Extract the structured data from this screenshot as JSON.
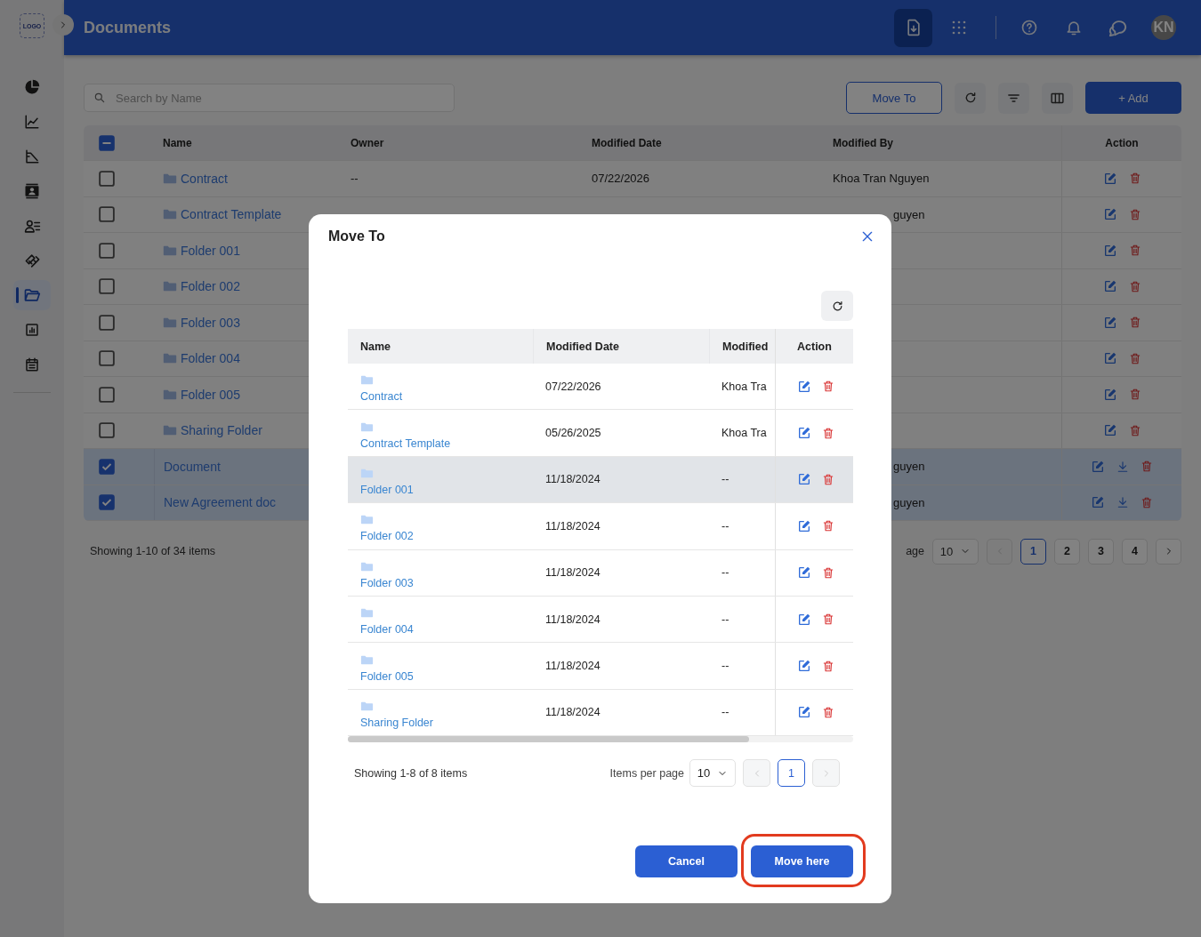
{
  "sidebar": {
    "logo": "LOGO",
    "items": [
      {
        "selected": false
      },
      {
        "selected": false
      },
      {
        "selected": false
      },
      {
        "selected": false
      },
      {
        "selected": false
      },
      {
        "selected": false
      },
      {
        "selected": true
      },
      {
        "selected": false
      },
      {
        "selected": false
      }
    ]
  },
  "header": {
    "title": "Documents",
    "avatar": "KN",
    "tools": [
      {
        "selected": true
      },
      {
        "selected": false
      }
    ]
  },
  "toolbar": {
    "search_placeholder": "Search by Name",
    "move_button": "Move To",
    "add_button": "+ Add"
  },
  "table": {
    "select_all": {
      "indeterminate": true
    },
    "columns": [
      "Name",
      "Owner",
      "Modified Date",
      "Modified By",
      "Action"
    ],
    "rows": [
      {
        "kind": "folder",
        "checked": false,
        "name": "Contract",
        "owner": "--",
        "modified_date": "07/22/2026",
        "modified_by": "Khoa Tran Nguyen"
      },
      {
        "kind": "folder",
        "checked": false,
        "name": "Contract Template",
        "modified_by_tail": "guyen"
      },
      {
        "kind": "folder",
        "checked": false,
        "name": "Folder 001"
      },
      {
        "kind": "folder",
        "checked": false,
        "name": "Folder 002"
      },
      {
        "kind": "folder",
        "checked": false,
        "name": "Folder 003"
      },
      {
        "kind": "folder",
        "checked": false,
        "name": "Folder 004"
      },
      {
        "kind": "folder",
        "checked": false,
        "name": "Folder 005"
      },
      {
        "kind": "folder",
        "checked": false,
        "name": "Sharing Folder"
      },
      {
        "kind": "document",
        "checked": true,
        "name": "Document",
        "modified_by_tail": "guyen"
      },
      {
        "kind": "document",
        "checked": true,
        "name": "New Agreement doc",
        "modified_by_tail": "guyen"
      }
    ]
  },
  "pagination": {
    "summary": "Showing 1-10 of 34 items",
    "per_page_label": "age",
    "per_page": "10",
    "prev_disabled": true,
    "next_disabled": false,
    "pages": [
      {
        "label": "1",
        "selected": true
      },
      {
        "label": "2",
        "selected": false
      },
      {
        "label": "3",
        "selected": false
      },
      {
        "label": "4",
        "selected": false
      }
    ]
  },
  "modal": {
    "title": "Move To",
    "columns": [
      "Name",
      "Modified Date",
      "Modified",
      "Action"
    ],
    "rows": [
      {
        "name": "Contract",
        "modified_date": "07/22/2026",
        "modified_by": "Khoa Tra",
        "selected": false
      },
      {
        "name": "Contract Template",
        "modified_date": "05/26/2025",
        "modified_by": "Khoa Tra",
        "selected": false
      },
      {
        "name": "Folder 001",
        "modified_date": "11/18/2024",
        "modified_by": "--",
        "selected": true
      },
      {
        "name": "Folder 002",
        "modified_date": "11/18/2024",
        "modified_by": "--",
        "selected": false
      },
      {
        "name": "Folder 003",
        "modified_date": "11/18/2024",
        "modified_by": "--",
        "selected": false
      },
      {
        "name": "Folder 004",
        "modified_date": "11/18/2024",
        "modified_by": "--",
        "selected": false
      },
      {
        "name": "Folder 005",
        "modified_date": "11/18/2024",
        "modified_by": "--",
        "selected": false
      },
      {
        "name": "Sharing Folder",
        "modified_date": "11/18/2024",
        "modified_by": "--",
        "selected": false
      }
    ],
    "summary": "Showing 1-8 of 8 items",
    "per_page_label": "Items per page",
    "per_page": "10",
    "prev_disabled": true,
    "next_disabled": true,
    "pages": [
      {
        "label": "1",
        "selected": true
      }
    ],
    "cancel_button": "Cancel",
    "confirm_button": "Move here",
    "confirm_highlighted": true
  }
}
